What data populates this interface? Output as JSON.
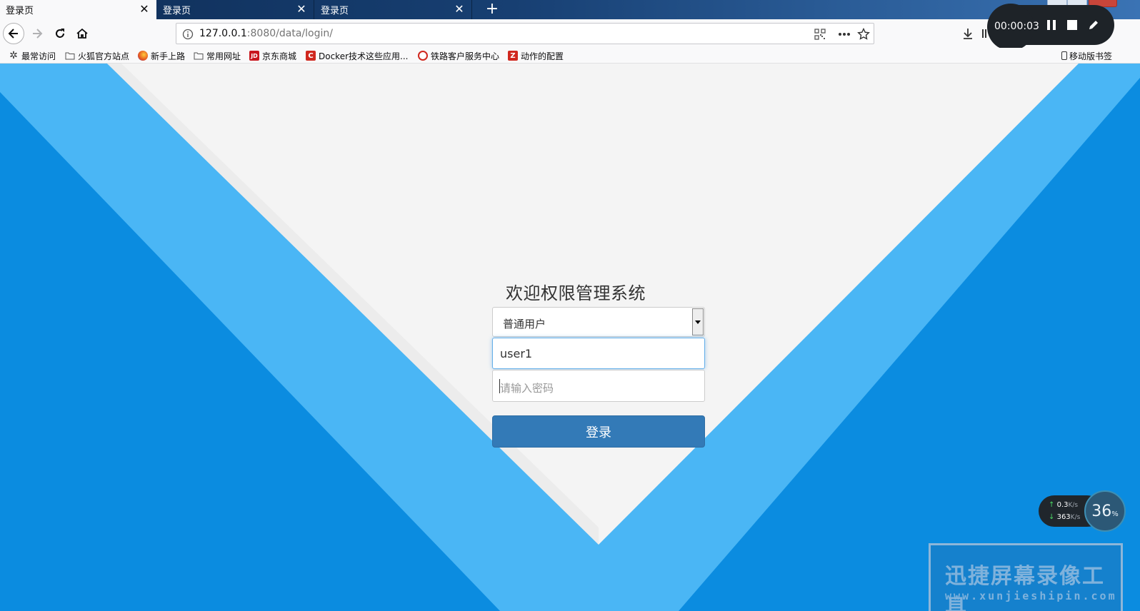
{
  "browser": {
    "tabs": [
      {
        "label": "登录页",
        "active": true
      },
      {
        "label": "登录页",
        "active": false
      },
      {
        "label": "登录页",
        "active": false
      }
    ],
    "url": {
      "host": "127.0.0.1",
      "rest": ":8080/data/login/"
    },
    "bookmarks": [
      {
        "label": "最常访问",
        "icon": "gear-icon"
      },
      {
        "label": "火狐官方站点",
        "icon": "folder-icon"
      },
      {
        "label": "新手上路",
        "icon": "firefox-icon"
      },
      {
        "label": "常用网址",
        "icon": "folder-icon"
      },
      {
        "label": "京东商城",
        "icon": "jd-icon",
        "glyph": "JD"
      },
      {
        "label": "Docker技术这些应用...",
        "icon": "c-icon",
        "glyph": "C"
      },
      {
        "label": "铁路客户服务中心",
        "icon": "railway-icon"
      },
      {
        "label": "动作的配置",
        "icon": "z-icon",
        "glyph": "Z"
      }
    ],
    "mobile_bookmarks": "移动版书签"
  },
  "recorder": {
    "time": "00:00:03"
  },
  "login": {
    "title": "欢迎权限管理系统",
    "role_select": {
      "value": "普通用户"
    },
    "username": {
      "value": "user1"
    },
    "password": {
      "placeholder": "请输入密码"
    },
    "submit_label": "登录"
  },
  "speed_widget": {
    "up": "0.3",
    "up_unit": "K/s",
    "down": "363",
    "down_unit": "K/s",
    "percent": "36",
    "percent_unit": "%"
  },
  "watermark": {
    "title": "迅捷屏幕录像工具",
    "url": "www.xunjieshipin.com"
  },
  "colors": {
    "page_blue": "#0b8ce0",
    "light_blue": "#4ab6f5",
    "button": "#337ab7",
    "gray_panel": "#f4f4f4"
  }
}
